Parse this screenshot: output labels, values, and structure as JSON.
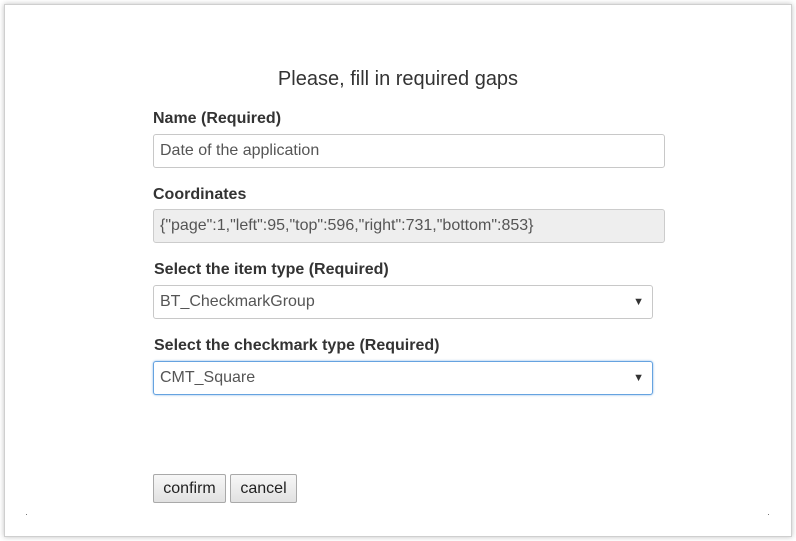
{
  "dialog": {
    "title": "Please, fill in required gaps",
    "name": {
      "label": "Name (Required)",
      "value": "Date of the application"
    },
    "coordinates": {
      "label": "Coordinates",
      "value": "{\"page\":1,\"left\":95,\"top\":596,\"right\":731,\"bottom\":853}"
    },
    "item_type": {
      "label": "Select the item type (Required)",
      "selected": "BT_CheckmarkGroup"
    },
    "checkmark_type": {
      "label": "Select the checkmark type (Required)",
      "selected": "CMT_Square"
    },
    "buttons": {
      "confirm": "confirm",
      "cancel": "cancel"
    },
    "icons": {
      "dropdown": "chevron-down-icon"
    },
    "colors": {
      "focus_border": "#66a3e0",
      "readonly_bg": "#eeeeee"
    }
  }
}
